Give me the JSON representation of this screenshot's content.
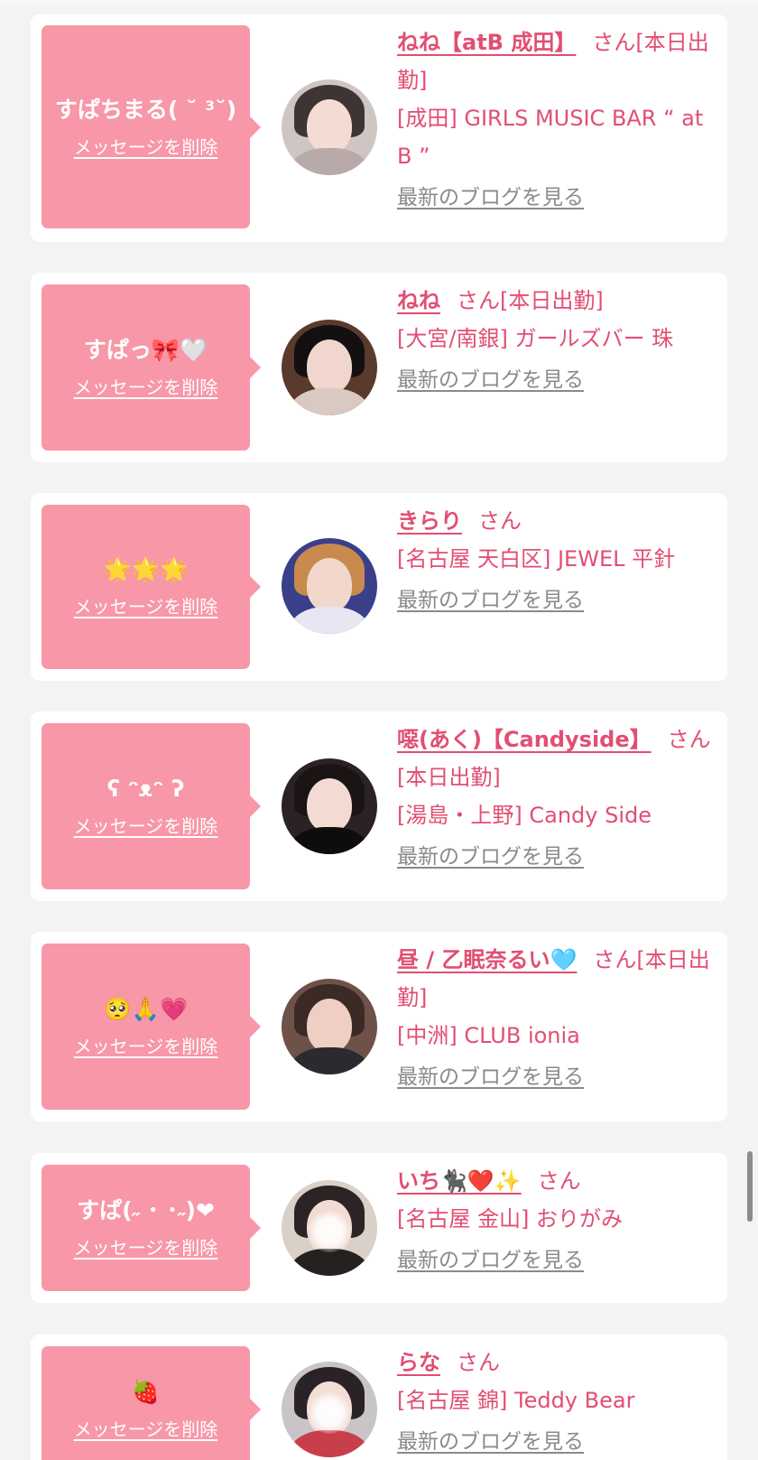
{
  "delete_label": "メッセージを削除",
  "blog_label": "最新のブログを見る",
  "san_label": "さん",
  "accent_color": "#e24e72",
  "bubble_color": "#f797a8",
  "cards": [
    {
      "message": "すぱちまる( ˘ ³˘)",
      "name": "ねね【atB 成田】",
      "suffix": "[本日出勤]",
      "shop": "[成田] GIRLS MUSIC BAR “ at B ”"
    },
    {
      "message": "すぱっ🎀🤍",
      "name": "ねね",
      "suffix": "[本日出勤]",
      "shop": "[大宮/南銀] ガールズバー 珠"
    },
    {
      "message": "🌟🌟🌟",
      "name": "きらり",
      "suffix": "",
      "shop": "[名古屋 天白区] JEWEL 平針"
    },
    {
      "message": "ʕ ᵔᴥᵔ ʔ",
      "name": "噁(あく)【Candyside】",
      "suffix": "[本日出勤]",
      "shop": "[湯島・上野] Candy Side"
    },
    {
      "message": "🥺🙏💗",
      "name": "昼 / 乙眠奈るい🩵",
      "suffix": "[本日出勤]",
      "shop": "[中洲] CLUB ionia"
    },
    {
      "message": "すぱ(˶ ･ ･˶)❤",
      "name": "いち🐈‍⬛❤️✨",
      "suffix": "",
      "shop": "[名古屋 金山] おりがみ"
    },
    {
      "message": "🍓",
      "name": "らな",
      "suffix": "",
      "shop": "[名古屋 錦] Teddy Bear"
    }
  ]
}
